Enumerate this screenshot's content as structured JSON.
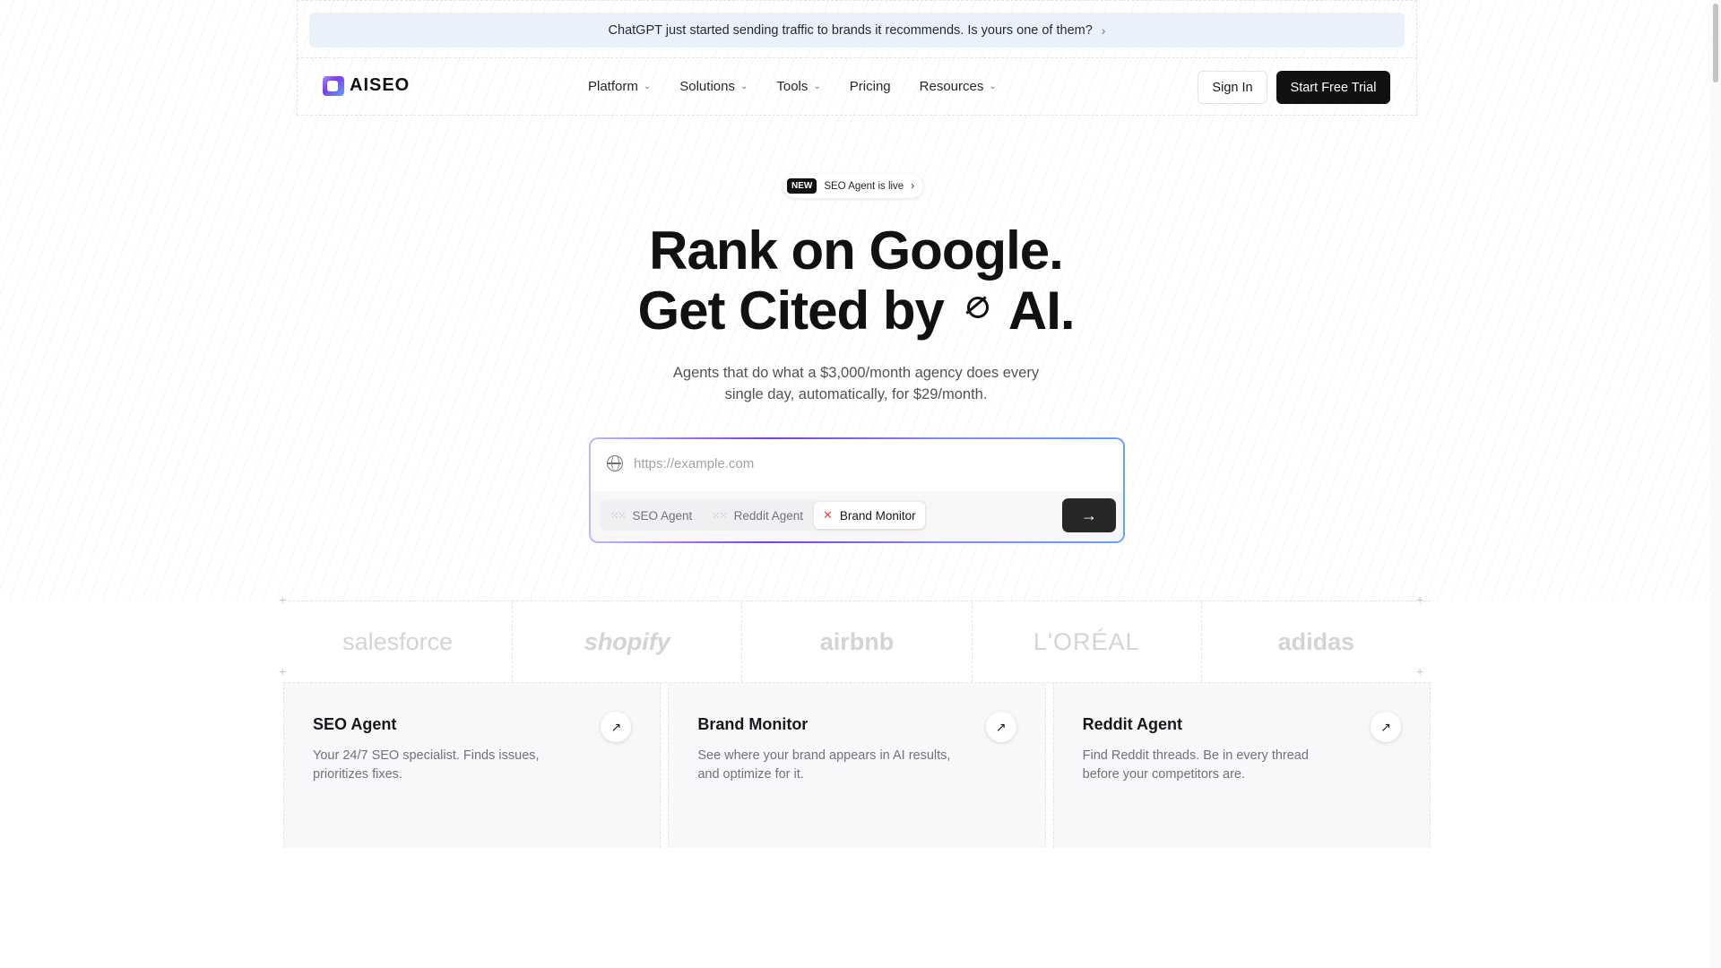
{
  "banner": {
    "text": "ChatGPT just started sending traffic to brands it recommends. Is yours one of them?",
    "chevron": "›"
  },
  "header": {
    "logo_text": "AISEO",
    "nav": [
      {
        "label": "Platform",
        "dropdown": true
      },
      {
        "label": "Solutions",
        "dropdown": true
      },
      {
        "label": "Tools",
        "dropdown": true
      },
      {
        "label": "Pricing",
        "dropdown": false
      },
      {
        "label": "Resources",
        "dropdown": true
      }
    ],
    "caret": "⌄",
    "sign_in": "Sign In",
    "start_trial": "Start Free Trial"
  },
  "hero": {
    "badge_new": "NEW",
    "badge_text": "SEO Agent is live",
    "badge_chevron": "›",
    "headline_line1": "Rank on Google.",
    "headline_line2_prefix": "Get Cited by",
    "headline_line2_suffix": "AI.",
    "subtitle": "Agents that do what a $3,000/month agency does every single day, automatically, for $29/month."
  },
  "search": {
    "placeholder": "https://example.com",
    "value": "",
    "tabs": [
      {
        "label": "SEO Agent",
        "icon": "grid-dots-icon",
        "active": false
      },
      {
        "label": "Reddit Agent",
        "icon": "grid-dots-icon",
        "active": false
      },
      {
        "label": "Brand Monitor",
        "icon": "x-cross-icon",
        "active": true
      }
    ],
    "submit_icon": "→"
  },
  "brands": [
    "salesforce",
    "shopify",
    "airbnb",
    "L'ORÉAL",
    "adidas"
  ],
  "cards": [
    {
      "title": "SEO Agent",
      "description": "Your 24/7 SEO specialist. Finds issues, prioritizes fixes."
    },
    {
      "title": "Brand Monitor",
      "description": "See where your brand appears in AI results, and optimize for it."
    },
    {
      "title": "Reddit Agent",
      "description": "Find Reddit threads. Be in every thread before your competitors are."
    }
  ],
  "card_arrow_icon": "↗",
  "colors": {
    "primary": "#111111",
    "banner_bg": "#e9f1fb",
    "accent_gradient": "#7c3aed"
  }
}
